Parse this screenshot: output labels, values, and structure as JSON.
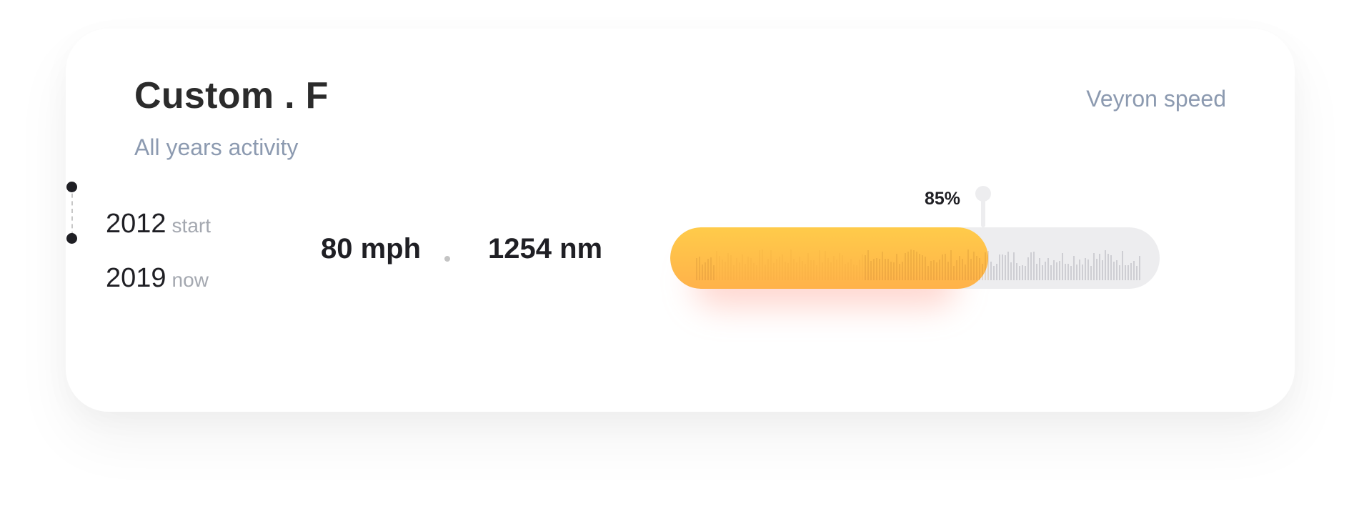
{
  "card": {
    "title": "Custom . F",
    "subtitle": "All years activity",
    "metric_label": "Veyron speed"
  },
  "timeline": {
    "start": {
      "year": "2012",
      "label": "start"
    },
    "end": {
      "year": "2019",
      "label": "now"
    }
  },
  "stats": {
    "speed": "80 mph",
    "torque": "1254 nm"
  },
  "progress": {
    "percent": 85,
    "percent_label": "85%"
  },
  "colors": {
    "fill_top": "#ffcb4a",
    "fill_bottom": "#ffb24a",
    "track": "#ededef",
    "muted_text": "#8c9ab0",
    "dark_text": "#1f1f24"
  }
}
